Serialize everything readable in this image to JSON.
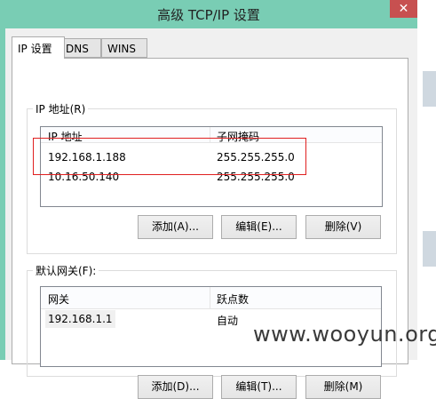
{
  "window": {
    "title": "高级 TCP/IP 设置",
    "close": "✕"
  },
  "tabs": [
    {
      "label": "IP 设置"
    },
    {
      "label": "DNS"
    },
    {
      "label": "WINS"
    }
  ],
  "ip_group": {
    "label": "IP 地址(R)",
    "columns": [
      "IP 地址",
      "子网掩码"
    ],
    "rows": [
      [
        "192.168.1.188",
        "255.255.255.0"
      ],
      [
        "10.16.50.140",
        "255.255.255.0"
      ]
    ],
    "buttons": [
      "添加(A)...",
      "编辑(E)...",
      "删除(V)"
    ]
  },
  "gateway_group": {
    "label": "默认网关(F):",
    "columns": [
      "网关",
      "跃点数"
    ],
    "rows": [
      [
        "192.168.1.1",
        "自动"
      ]
    ],
    "buttons": [
      "添加(D)...",
      "编辑(T)...",
      "删除(M)"
    ]
  },
  "watermark": "www.wooyun.org"
}
